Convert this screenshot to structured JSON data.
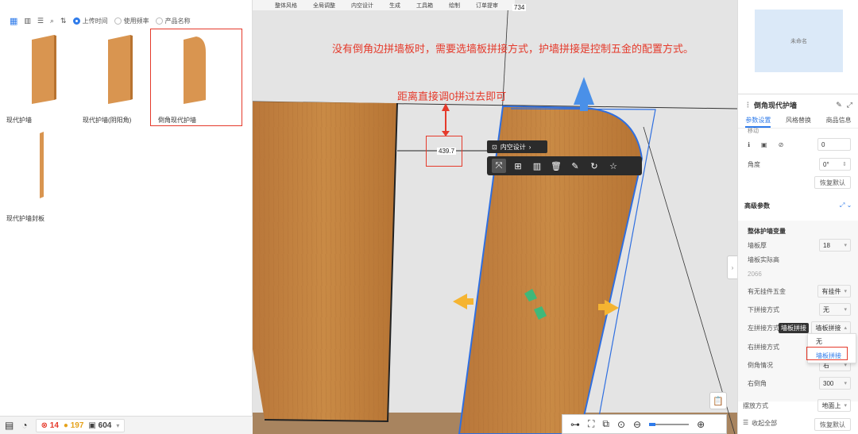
{
  "toolbar": {
    "items": [
      "整体风格",
      "全局调整",
      "内空设计",
      "生成",
      "工具箱",
      "绘制",
      "订单提审"
    ]
  },
  "viewport": {
    "ruler_value": "734",
    "annotation_main": "没有倒角边拼墙板时，需要选墙板拼接方式，护墙拼接是控制五金的配置方式。",
    "annotation_distance": "距离直接调0拼过去即可",
    "dimension_value": "439.7",
    "context_menu_title": "内空设计"
  },
  "library": {
    "filter_options": [
      "上传时间",
      "使用频率",
      "产品名称"
    ],
    "items": [
      {
        "label": "现代护墙"
      },
      {
        "label": "现代护墙(阴阳角)"
      },
      {
        "label": "倒角现代护墙"
      },
      {
        "label": "现代护墙封板"
      }
    ]
  },
  "status": {
    "errors": "14",
    "warnings": "197",
    "count": "604"
  },
  "props": {
    "preview_label": "未命名",
    "title": "倒角现代护墙",
    "tabs": [
      "参数设置",
      "风格替换",
      "商品信息"
    ],
    "move_label": "移动",
    "move_value": "0",
    "angle_label": "角度",
    "angle_value": "0°",
    "reset_label": "恢复默认",
    "advanced_title": "高级参数",
    "group_title": "整体护墙变量",
    "rows": [
      {
        "label": "墙板厚",
        "value": "18"
      },
      {
        "label": "墙板实际高",
        "value": "2066"
      },
      {
        "label": "有无挂件五金",
        "value": "有挂件"
      },
      {
        "label": "下拼接方式",
        "value": "无"
      },
      {
        "label": "左拼接方式",
        "value": "墙板拼接"
      },
      {
        "label": "右拼接方式",
        "value": ""
      },
      {
        "label": "倒角情况",
        "value": "右"
      },
      {
        "label": "右倒角",
        "value": "300"
      },
      {
        "label": "摆放方式",
        "value": "地面上"
      }
    ],
    "tooltip": "墙板拼接",
    "dropdown_options": [
      "无",
      "墙板拼接"
    ],
    "collapse_all": "收起全部",
    "reset_all": "恢复默认"
  },
  "colors": {
    "accent": "#2f7bea",
    "annotation": "#e53a2b",
    "wood": "#c98a45"
  }
}
